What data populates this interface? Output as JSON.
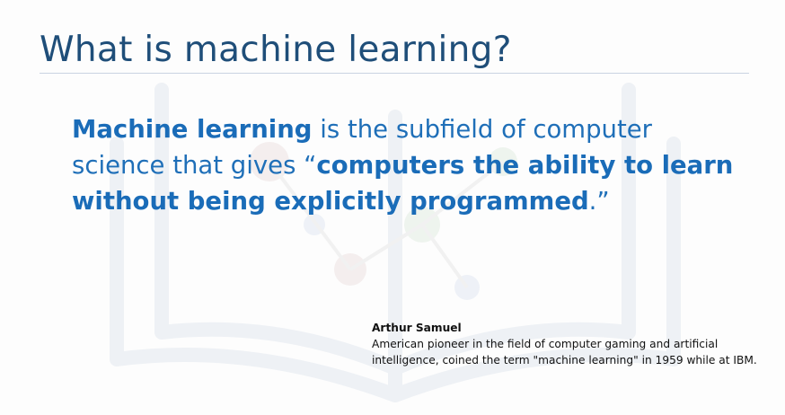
{
  "slide": {
    "title": "What is machine learning?",
    "definition": {
      "term": "Machine learning",
      "text_1": " is the subfield of computer science that gives ",
      "open_quote": "“",
      "emphasis": "computers the ability to learn without being explicitly programmed",
      "close": ".”"
    },
    "attribution": {
      "name": "Arthur Samuel",
      "bio": "American pioneer in the field of computer gaming and artificial intelligence, coined the term \"machine learning\" in 1959 while at IBM."
    }
  },
  "colors": {
    "title": "#1f4e79",
    "definition": "#1f6fb8",
    "body_text": "#111111"
  }
}
